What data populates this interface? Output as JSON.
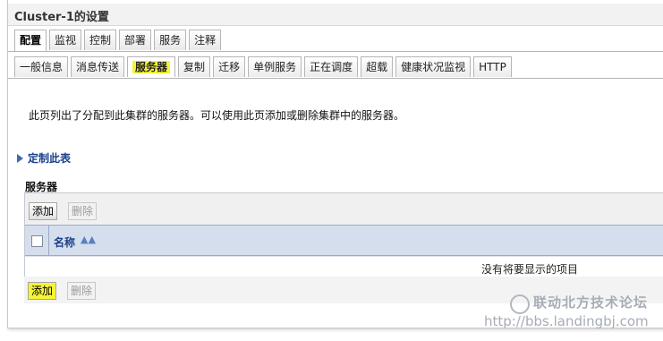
{
  "title": "Cluster-1的设置",
  "tabs_level1": [
    "配置",
    "监视",
    "控制",
    "部署",
    "服务",
    "注释"
  ],
  "tabs_level2": [
    "一般信息",
    "消息传送",
    "服务器",
    "复制",
    "迁移",
    "单例服务",
    "正在调度",
    "超载",
    "健康状况监视",
    "HTTP"
  ],
  "intro_text": "此页列出了分配到此集群的服务器。可以使用此页添加或删除集群中的服务器。",
  "customize_label": "定制此表",
  "section_title": "服务器",
  "buttons": {
    "add": "添加",
    "delete": "删除"
  },
  "table": {
    "column_name": "名称",
    "sort_icon": "▲▲",
    "empty_message": "没有将要显示的项目"
  },
  "watermark": {
    "name": "联动北方技术论坛",
    "url": "http://bbs.landingbj.com"
  },
  "colors": {
    "highlight": "#f4f435",
    "header_bg": "#d4deed",
    "link": "#1a3f8a"
  }
}
